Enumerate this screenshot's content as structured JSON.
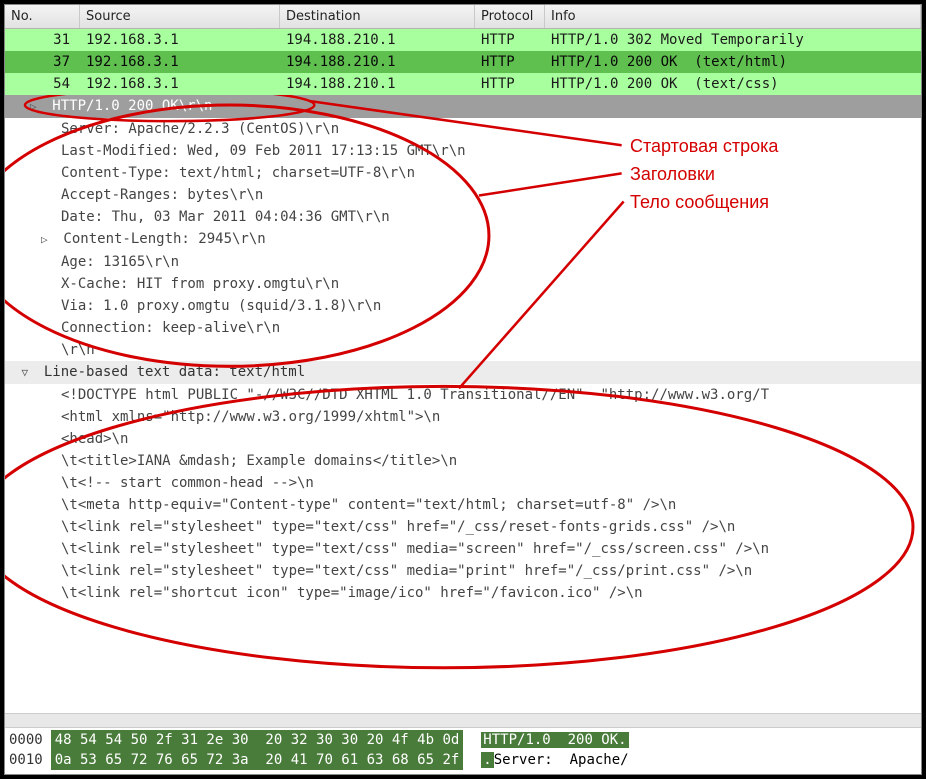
{
  "columns": {
    "no": "No.",
    "src": "Source",
    "dst": "Destination",
    "proto": "Protocol",
    "info": "Info"
  },
  "packets": [
    {
      "no": "31",
      "src": "192.168.3.1",
      "dst": "194.188.210.1",
      "proto": "HTTP",
      "info": "HTTP/1.0 302 Moved Temporarily",
      "cls": "green-light"
    },
    {
      "no": "37",
      "src": "192.168.3.1",
      "dst": "194.188.210.1",
      "proto": "HTTP",
      "info": "HTTP/1.0 200 OK  (text/html)",
      "cls": "green-dark"
    },
    {
      "no": "54",
      "src": "192.168.3.1",
      "dst": "194.188.210.1",
      "proto": "HTTP",
      "info": "HTTP/1.0 200 OK  (text/css)",
      "cls": "green-light"
    }
  ],
  "status_line": "HTTP/1.0 200 OK\\r\\n",
  "headers": [
    "Server: Apache/2.2.3 (CentOS)\\r\\n",
    "Last-Modified: Wed, 09 Feb 2011 17:13:15 GMT\\r\\n",
    "Content-Type: text/html; charset=UTF-8\\r\\n",
    "Accept-Ranges: bytes\\r\\n",
    "Date: Thu, 03 Mar 2011 04:04:36 GMT\\r\\n",
    "Content-Length: 2945\\r\\n",
    "Age: 13165\\r\\n",
    "X-Cache: HIT from proxy.omgtu\\r\\n",
    "Via: 1.0 proxy.omgtu (squid/3.1.8)\\r\\n",
    "Connection: keep-alive\\r\\n",
    "\\r\\n"
  ],
  "body_header": "Line-based text data: text/html",
  "body_lines": [
    "<!DOCTYPE html PUBLIC \"-//W3C//DTD XHTML 1.0 Transitional//EN\"  \"http://www.w3.org/T",
    "<html xmlns=\"http://www.w3.org/1999/xhtml\">\\n",
    "<head>\\n",
    "\\t<title>IANA &mdash; Example domains</title>\\n",
    "\\t<!-- start common-head -->\\n",
    "\\t<meta http-equiv=\"Content-type\" content=\"text/html; charset=utf-8\" />\\n",
    "\\t<link rel=\"stylesheet\" type=\"text/css\" href=\"/_css/reset-fonts-grids.css\" />\\n",
    "\\t<link rel=\"stylesheet\" type=\"text/css\" media=\"screen\" href=\"/_css/screen.css\" />\\n",
    "\\t<link rel=\"stylesheet\" type=\"text/css\" media=\"print\" href=\"/_css/print.css\" />\\n",
    "\\t<link rel=\"shortcut icon\" type=\"image/ico\" href=\"/favicon.ico\" />\\n"
  ],
  "annotations": {
    "a1": "Стартовая строка",
    "a2": "Заголовки",
    "a3": "Тело сообщения"
  },
  "hex": {
    "rows": [
      {
        "off": "0000",
        "bytes": "48 54 54 50 2f 31 2e 30  20 32 30 30 20 4f 4b 0d",
        "ascii_hl": "HTTP/1.0  200 OK.",
        "ascii_rest": ""
      },
      {
        "off": "0010",
        "bytes": "0a 53 65 72 76 65 72 3a  20 41 70 61 63 68 65 2f",
        "ascii_hl": ".",
        "ascii_rest": "Server:  Apache/"
      }
    ]
  }
}
